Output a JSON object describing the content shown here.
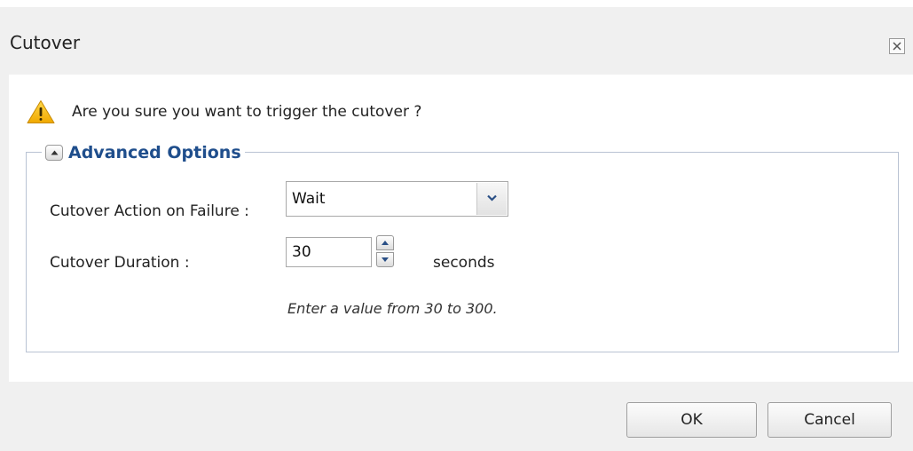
{
  "dialog": {
    "title": "Cutover"
  },
  "icons": {
    "close": "close-icon",
    "warning": "warning-icon",
    "collapse": "collapse-up-icon",
    "dropdown": "chevron-down-icon",
    "spin_up": "spin-up-icon",
    "spin_down": "spin-down-icon"
  },
  "message": {
    "text": "Are you sure you want to trigger the cutover ?"
  },
  "advanced": {
    "title": "Advanced Options",
    "action_label": "Cutover Action on Failure :",
    "action_value": "Wait",
    "duration_label": "Cutover Duration :",
    "duration_value": "30",
    "duration_unit": "seconds",
    "hint": "Enter a value from 30 to 300."
  },
  "footer": {
    "ok_label": "OK",
    "cancel_label": "Cancel"
  },
  "colors": {
    "accent": "#1f4e8c",
    "warning": "#f5b800",
    "background": "#f0f0f0",
    "panel": "#ffffff"
  }
}
